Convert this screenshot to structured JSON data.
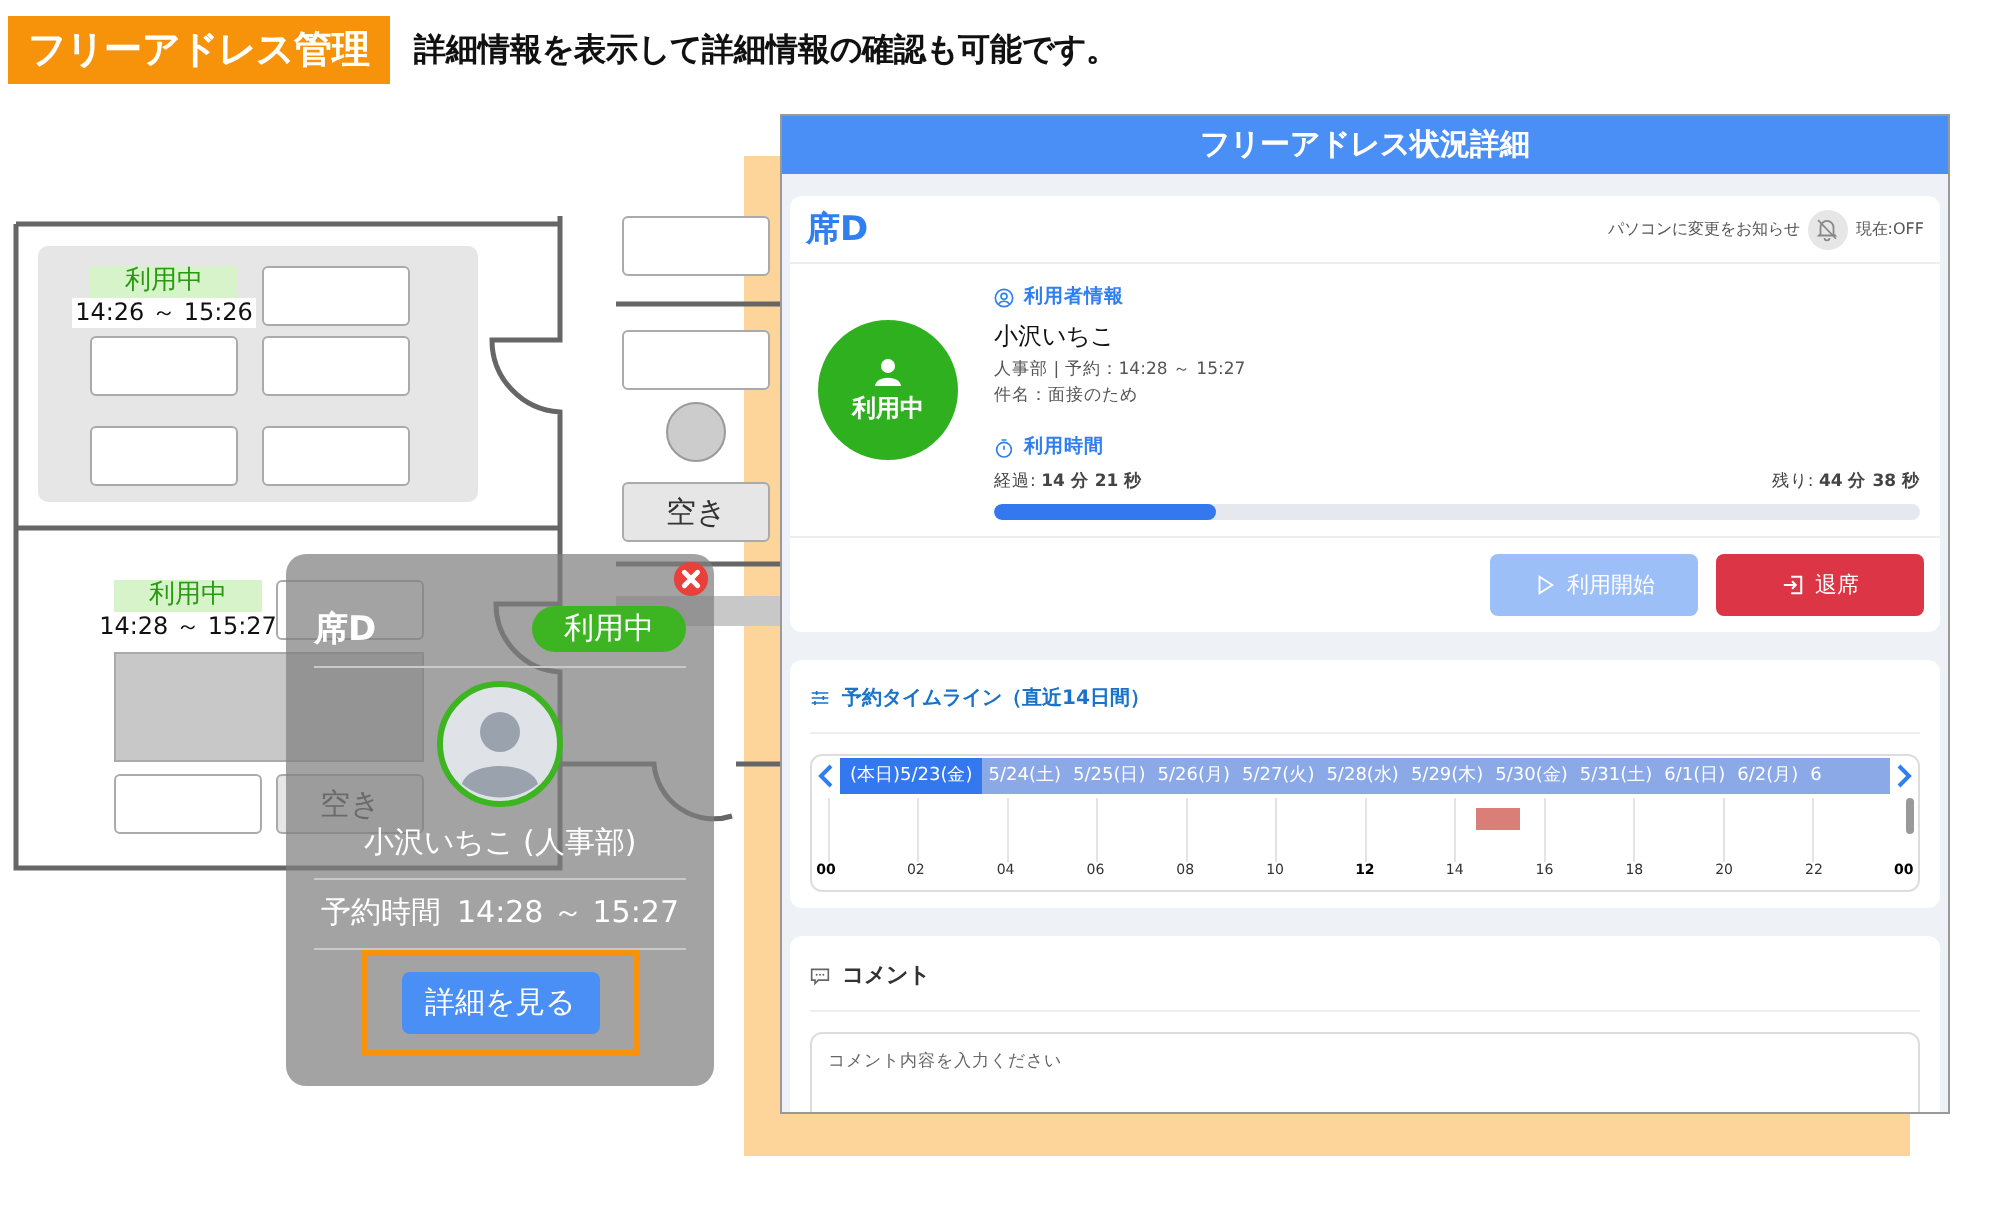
{
  "header": {
    "badge": "フリーアドレス管理",
    "caption": "詳細情報を表示して詳細情報の確認も可能です。"
  },
  "floor_plan": {
    "seats": [
      {
        "kind": "busy",
        "status": "利用中",
        "time": "14:26 ～ 15:26"
      },
      {
        "kind": "empty"
      },
      {
        "kind": "empty"
      },
      {
        "kind": "empty"
      },
      {
        "kind": "empty"
      },
      {
        "kind": "empty"
      },
      {
        "kind": "busy",
        "status": "利用中",
        "time": "14:28 ～ 15:27"
      },
      {
        "kind": "empty"
      },
      {
        "kind": "table"
      },
      {
        "kind": "empty"
      },
      {
        "kind": "free",
        "label": "空き"
      },
      {
        "kind": "empty"
      },
      {
        "kind": "empty"
      },
      {
        "kind": "round"
      },
      {
        "kind": "free",
        "label": "空き"
      },
      {
        "kind": "bar"
      }
    ]
  },
  "popup": {
    "seat": "席D",
    "status": "利用中",
    "name": "小沢いちこ (人事部)",
    "time_label": "予約時間",
    "time": "14:28 ～ 15:27",
    "button": "詳細を見る"
  },
  "panel": {
    "title": "フリーアドレス状況詳細",
    "seat": "席D",
    "notify": {
      "label": "パソコンに変更をお知らせ",
      "state": "現在:OFF",
      "on": false
    },
    "status": "利用中",
    "user_section": "利用者情報",
    "user_name": "小沢いちこ",
    "user_detail": "人事部 | 予約：14:28 ～ 15:27",
    "subject": "件名：面接のため",
    "time_section": "利用時間",
    "elapsed": "経過: **14 分 21 秒**",
    "remaining": "残り: **44 分 38 秒**",
    "progress": {
      "level": 0.24
    },
    "buttons": [
      {
        "kind": "start",
        "label": "利用開始",
        "disabled": true
      },
      {
        "kind": "leave",
        "label": "退席",
        "disabled": false
      }
    ],
    "timeline": {
      "title": "予約タイムライン（直近14日間）",
      "dates": [
        {
          "label": "(本日)5/23(金)",
          "selected": true
        },
        {
          "label": "5/24(土)",
          "selected": false
        },
        {
          "label": "5/25(日)",
          "selected": false
        },
        {
          "label": "5/26(月)",
          "selected": false
        },
        {
          "label": "5/27(火)",
          "selected": false
        },
        {
          "label": "5/28(水)",
          "selected": false
        },
        {
          "label": "5/29(木)",
          "selected": false
        },
        {
          "label": "5/30(金)",
          "selected": false
        },
        {
          "label": "5/31(土)",
          "selected": false
        },
        {
          "label": "6/1(日)",
          "selected": false
        },
        {
          "label": "6/2(月)",
          "selected": false
        },
        {
          "label": "6",
          "selected": false
        }
      ],
      "hours": [
        {
          "label": "00",
          "emphasis": true
        },
        {
          "label": "02",
          "emphasis": false
        },
        {
          "label": "04",
          "emphasis": false
        },
        {
          "label": "06",
          "emphasis": false
        },
        {
          "label": "08",
          "emphasis": false
        },
        {
          "label": "10",
          "emphasis": false
        },
        {
          "label": "12",
          "emphasis": true
        },
        {
          "label": "14",
          "emphasis": false
        },
        {
          "label": "16",
          "emphasis": false
        },
        {
          "label": "18",
          "emphasis": false
        },
        {
          "label": "20",
          "emphasis": false
        },
        {
          "label": "22",
          "emphasis": false
        },
        {
          "label": "00",
          "emphasis": true
        }
      ]
    },
    "comment": {
      "title": "コメント",
      "placeholder": "コメント内容を入力ください"
    }
  }
}
